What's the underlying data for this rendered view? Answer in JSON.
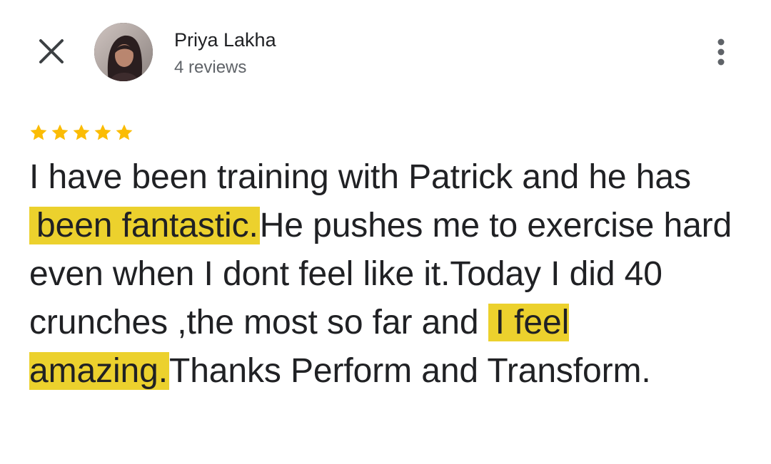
{
  "reviewer": {
    "name": "Priya Lakha",
    "reviews_count": "4 reviews",
    "avatar_icon": "avatar-photo"
  },
  "header": {
    "close_icon": "close-icon",
    "more_icon": "more-vert-icon"
  },
  "rating": {
    "stars": 5,
    "max": 5,
    "color": "#fbbc04"
  },
  "review": {
    "part1": "I have been training with Patrick and he has",
    "highlight1": "been fantastic.",
    "part2": "He pushes me to exercise hard even when I dont feel like it.Today I did 40 crunches ,the most so far and",
    "highlight2": "I feel amazing.",
    "part3": "Thanks Perform and Transform.",
    "highlight_color": "#ecd12d"
  }
}
